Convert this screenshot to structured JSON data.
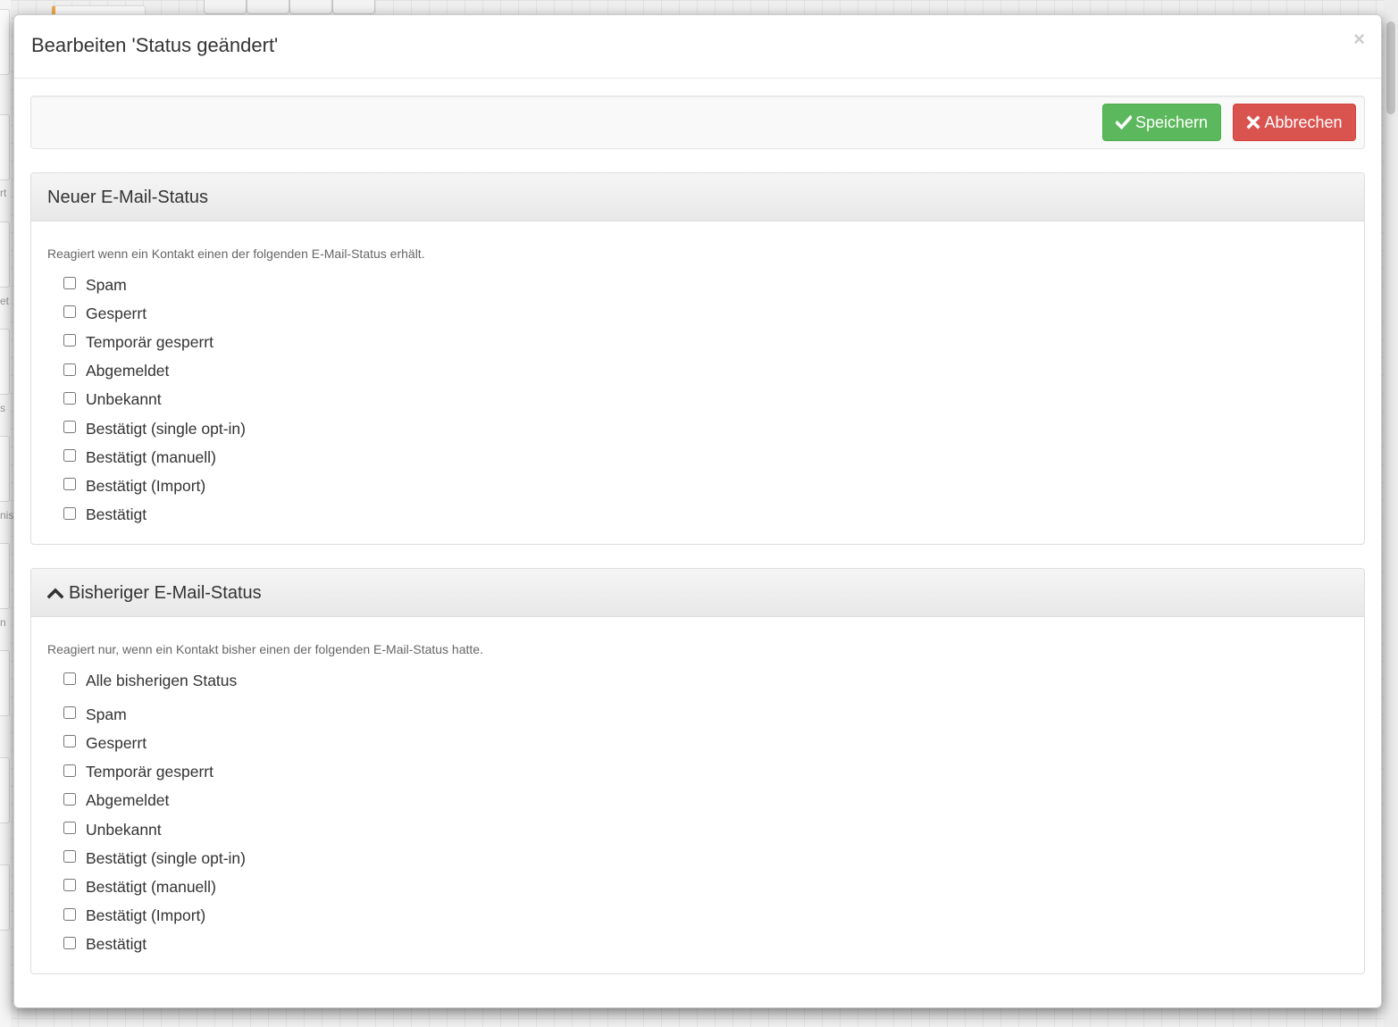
{
  "background": {
    "left_fragments": [
      "rt",
      "et",
      "s",
      "nis",
      "n"
    ]
  },
  "modal": {
    "title": "Bearbeiten 'Status geändert'",
    "close_label": "×"
  },
  "toolbar": {
    "save_label": "Speichern",
    "cancel_label": "Abbrechen",
    "save_color": "#5cb85c",
    "cancel_color": "#d9534f"
  },
  "panel_new": {
    "title": "Neuer E-Mail-Status",
    "description": "Reagiert wenn ein Kontakt einen der folgenden E-Mail-Status erhält.",
    "options": [
      {
        "label": "Spam",
        "checked": false
      },
      {
        "label": "Gesperrt",
        "checked": false
      },
      {
        "label": "Temporär gesperrt",
        "checked": false
      },
      {
        "label": "Abgemeldet",
        "checked": false
      },
      {
        "label": "Unbekannt",
        "checked": false
      },
      {
        "label": "Bestätigt (single opt-in)",
        "checked": false
      },
      {
        "label": "Bestätigt (manuell)",
        "checked": false
      },
      {
        "label": "Bestätigt (Import)",
        "checked": false
      },
      {
        "label": "Bestätigt",
        "checked": false
      }
    ]
  },
  "panel_previous": {
    "title": "Bisheriger E-Mail-Status",
    "collapse_icon": "chevron-up-icon",
    "description": "Reagiert nur, wenn ein Kontakt bisher einen der folgenden E-Mail-Status hatte.",
    "all_option": {
      "label": "Alle bisherigen Status",
      "checked": false
    },
    "options": [
      {
        "label": "Spam",
        "checked": false
      },
      {
        "label": "Gesperrt",
        "checked": false
      },
      {
        "label": "Temporär gesperrt",
        "checked": false
      },
      {
        "label": "Abgemeldet",
        "checked": false
      },
      {
        "label": "Unbekannt",
        "checked": false
      },
      {
        "label": "Bestätigt (single opt-in)",
        "checked": false
      },
      {
        "label": "Bestätigt (manuell)",
        "checked": false
      },
      {
        "label": "Bestätigt (Import)",
        "checked": false
      },
      {
        "label": "Bestätigt",
        "checked": false
      }
    ]
  }
}
